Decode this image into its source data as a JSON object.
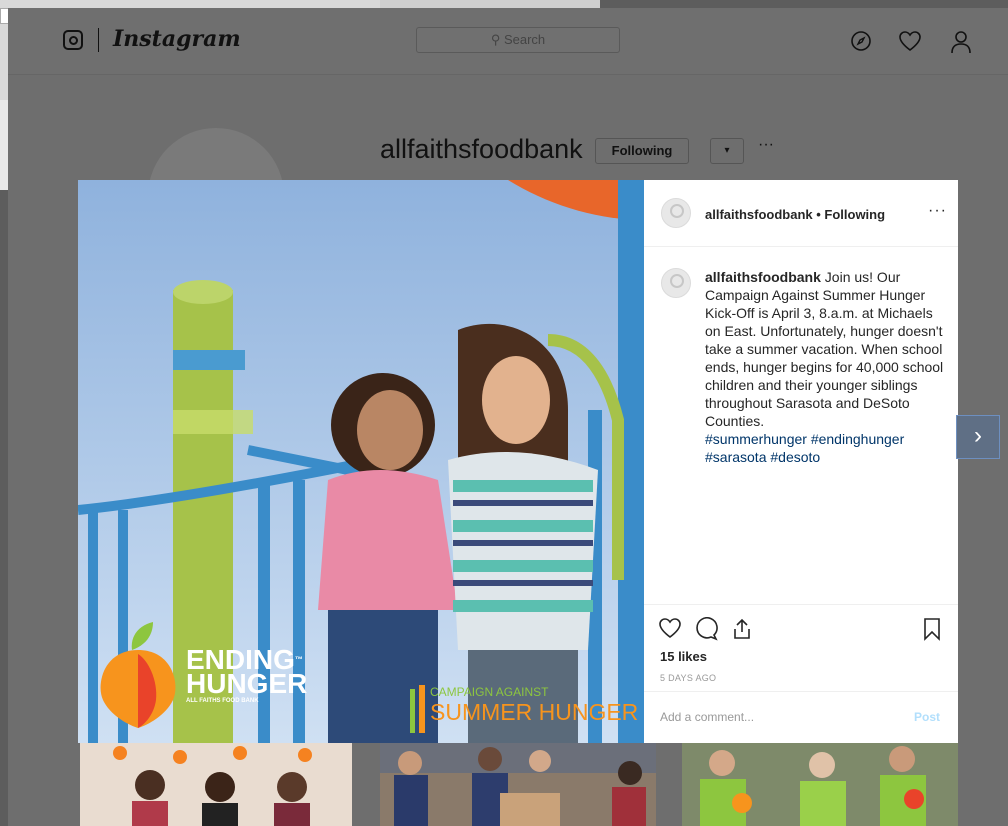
{
  "header": {
    "logo_text": "Instagram",
    "search_placeholder": "Search"
  },
  "profile": {
    "username": "allfaithsfoodbank",
    "following_label": "Following",
    "dropdown_glyph": "▾",
    "more_glyph": "···"
  },
  "post": {
    "header_user": "allfaithsfoodbank • Following",
    "more_glyph": "···",
    "caption_user": "allfaithsfoodbank",
    "caption_text": " Join us! Our Campaign Against Summer Hunger Kick-Off is April 3, 8.a.m. at Michaels on East. Unfortunately, hunger doesn't take a summer vacation. When school ends, hunger begins for 40,000 school children and their younger siblings throughout Sarasota and DeSoto Counties.",
    "hashtags": "#summerhunger #endinghunger #sarasota #desoto",
    "likes": "15 likes",
    "date": "5 DAYS AGO",
    "comment_placeholder": "Add a comment...",
    "post_label": "Post"
  },
  "photo_overlay": {
    "brand_line1": "ENDING",
    "brand_line2": "HUNGER",
    "brand_tm": "™",
    "brand_sub": "ALL FAITHS FOOD BANK",
    "campaign_line1": "CAMPAIGN AGAINST",
    "campaign_line2": "SUMMER HUNGER"
  },
  "icons": {
    "next": "›",
    "explore": "compass-icon",
    "heart": "heart-icon",
    "user": "user-icon"
  },
  "colors": {
    "hashtag": "#003569",
    "post_button": "#b2dffc",
    "campaign_green": "#8dc63f",
    "campaign_orange": "#f7941d"
  }
}
